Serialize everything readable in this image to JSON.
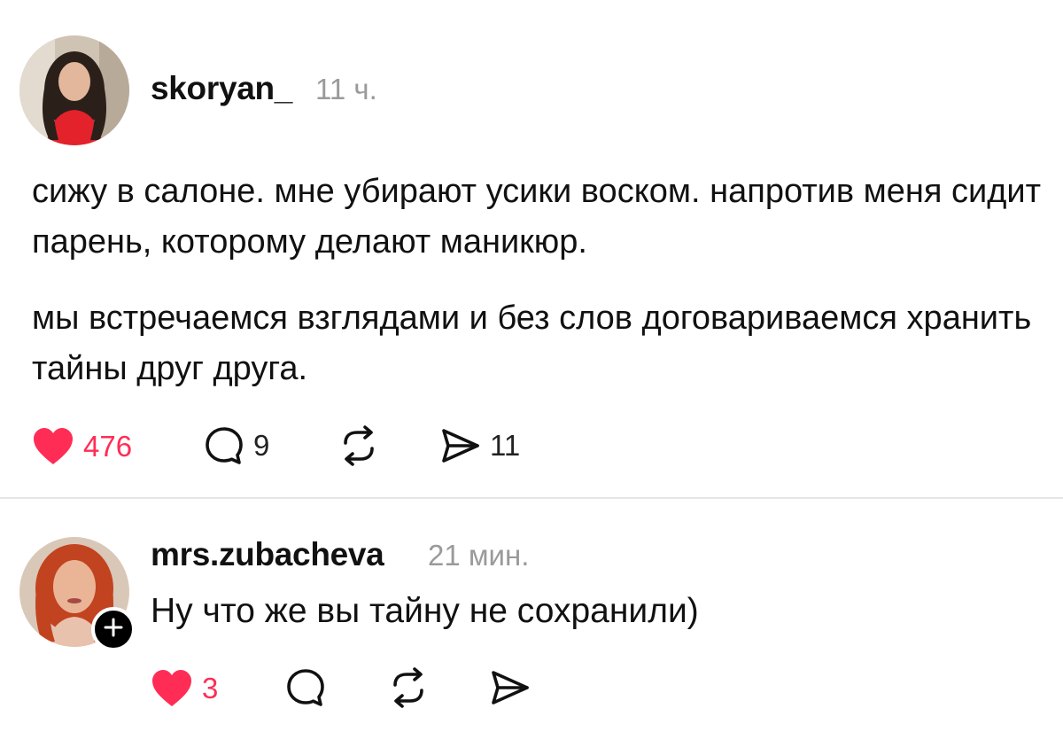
{
  "post": {
    "username": "skoryan_",
    "time": "11 ч.",
    "paragraphs": [
      "сижу в салоне. мне убирают усики воском. напротив меня сидит парень, которому делают маникюр.",
      "мы встречаемся взглядами и без слов договариваемся хранить тайны друг друга."
    ],
    "likes": "476",
    "comments": "9",
    "shares": "11",
    "liked": true
  },
  "reply": {
    "username": "mrs.zubacheva",
    "time": "21 мин.",
    "text": "Ну что же вы тайну не сохранили)",
    "likes": "3",
    "liked": true
  },
  "icons": {
    "like": "heart-icon",
    "comment": "comment-bubble-icon",
    "repost": "repost-icon",
    "share": "send-icon",
    "follow": "plus-icon"
  },
  "colors": {
    "like": "#ff2d55",
    "text": "#111111",
    "muted": "#9a9a9a",
    "divider": "#e6e6e6"
  }
}
